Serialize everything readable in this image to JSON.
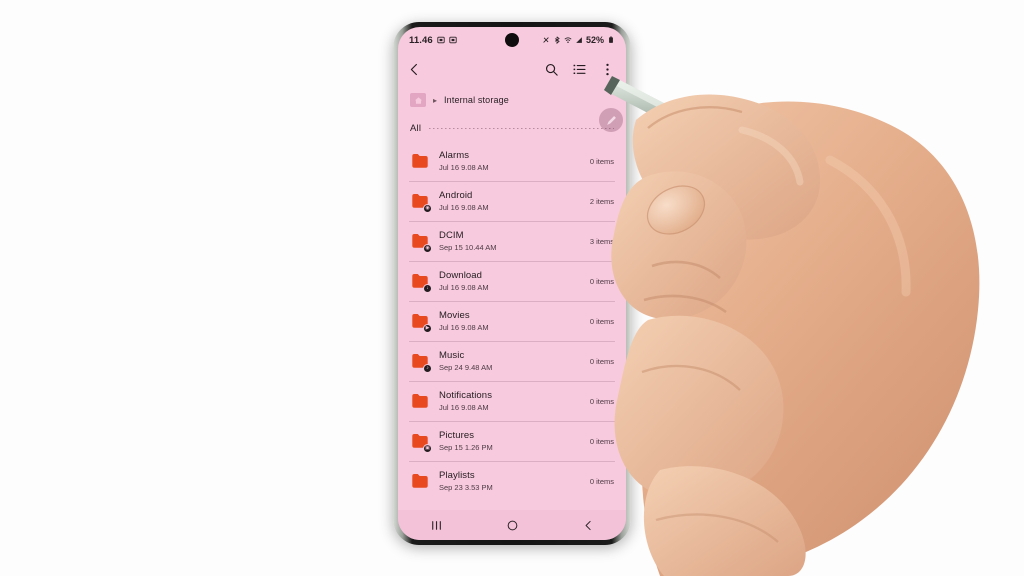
{
  "device": {
    "status_bar": {
      "time": "11.46",
      "battery": "52%",
      "left_icons": [
        "notification-badge-icon",
        "notification-badge-icon"
      ],
      "right_icons": [
        "nfc-icon",
        "bluetooth-icon",
        "wifi-icon",
        "signal-icon",
        "battery-icon"
      ]
    },
    "nav_bar": {
      "recents_label": "recents-icon",
      "home_label": "home-icon",
      "back_label": "back-icon"
    }
  },
  "app": {
    "toolbar": {
      "back_icon": "back-arrow-icon",
      "search_icon": "search-icon",
      "view_icon": "list-view-icon",
      "more_icon": "more-options-icon"
    },
    "breadcrumb": {
      "home_icon": "home-folder-icon",
      "separator": "▸",
      "path": "Internal storage"
    },
    "section": {
      "label": "All"
    },
    "cursor": {
      "icon": "stylus-pointer-icon"
    },
    "files": [
      {
        "name": "Alarms",
        "date": "Jul 16 9.08 AM",
        "count": "0 items",
        "badge": "",
        "icon": "folder-icon"
      },
      {
        "name": "Android",
        "date": "Jul 16 9.08 AM",
        "count": "2 items",
        "badge": "◉",
        "icon": "folder-system-icon"
      },
      {
        "name": "DCIM",
        "date": "Sep 15 10.44 AM",
        "count": "3 items",
        "badge": "◉",
        "icon": "folder-camera-icon"
      },
      {
        "name": "Download",
        "date": "Jul 16 9.08 AM",
        "count": "0 items",
        "badge": "↓",
        "icon": "folder-download-icon"
      },
      {
        "name": "Movies",
        "date": "Jul 16 9.08 AM",
        "count": "0 items",
        "badge": "▶",
        "icon": "folder-video-icon"
      },
      {
        "name": "Music",
        "date": "Sep 24 9.48 AM",
        "count": "0 items",
        "badge": "♪",
        "icon": "folder-music-icon"
      },
      {
        "name": "Notifications",
        "date": "Jul 16 9.08 AM",
        "count": "0 items",
        "badge": "",
        "icon": "folder-icon"
      },
      {
        "name": "Pictures",
        "date": "Sep 15 1.26 PM",
        "count": "0 items",
        "badge": "▣",
        "icon": "folder-pictures-icon"
      },
      {
        "name": "Playlists",
        "date": "Sep 23 3.53 PM",
        "count": "0 items",
        "badge": "",
        "icon": "folder-icon"
      }
    ]
  },
  "colors": {
    "screen_background": "#f7cadd",
    "folder_orange": "#e8491e",
    "text_primary": "#241c20",
    "text_secondary": "#4d3b44",
    "nav_background": "#f3c2d8"
  }
}
